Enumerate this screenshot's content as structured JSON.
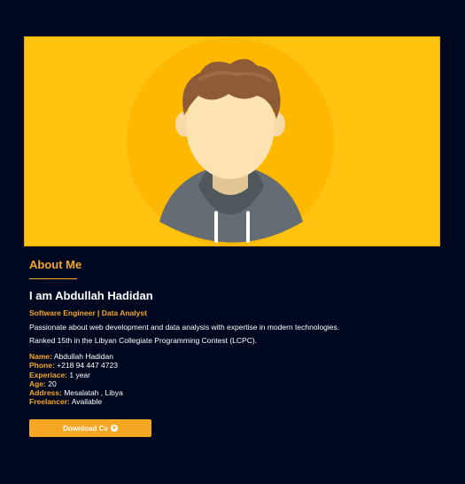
{
  "about": {
    "section_title": "About Me",
    "heading": "I am Abdullah Hadidan",
    "role": "Software Engineer | Data Analyst",
    "description_1": "Passionate about web development and data analysis with expertise in modern technologies.",
    "description_2": "Ranked 15th in the Libyan Collegiate Programming Contest (LCPC)."
  },
  "info": [
    {
      "label": "Name:",
      "value": " Abdullah Hadidan"
    },
    {
      "label": "Phone:",
      "value": " +218 94 447 4723"
    },
    {
      "label": "Experiace:",
      "value": " 1 year"
    },
    {
      "label": "Age:",
      "value": " 20"
    },
    {
      "label": "Address:",
      "value": " Mesalatah , Libya"
    },
    {
      "label": "Freelancer:",
      "value": " Available"
    }
  ],
  "download_button": {
    "label": "Download Cv",
    "icon": "download-icon"
  },
  "colors": {
    "background": "#000820",
    "accent": "#f5a623",
    "hero_background": "#ffc20f",
    "hero_circle": "#ffbc00"
  }
}
